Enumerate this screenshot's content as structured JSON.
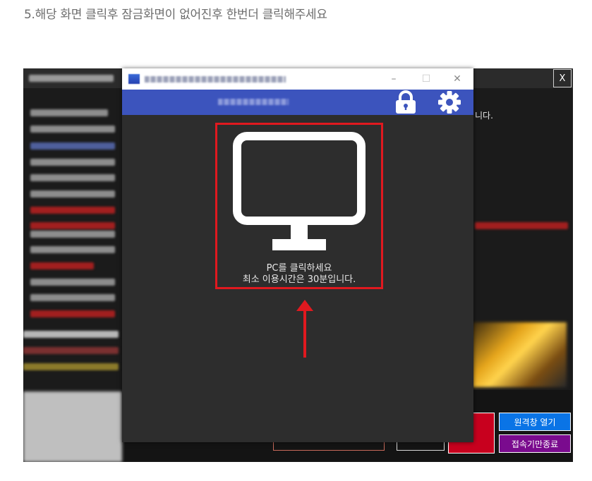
{
  "instruction": "5.해당 화면 클릭후 잠금화면이 없어진후 한번더 클릭해주세요",
  "background_app": {
    "close_label": "X",
    "notice_text": "니다.",
    "buttons": {
      "start_time_label": "",
      "usage_time_label": "",
      "pc_end_label": "",
      "remote_window_label": "원격창 열기",
      "disconnect_label": "접속기만종료"
    }
  },
  "lock_window": {
    "controls": {
      "minimize": "–",
      "maximize": "☐",
      "close": "✕"
    },
    "icons": {
      "lock": "lock-icon",
      "settings": "gear-icon",
      "monitor": "monitor-icon"
    },
    "click_prompt": "PC를 클릭하세요",
    "min_time_text": "최소 이용시간은 30분입니다."
  },
  "colors": {
    "header_blue": "#3c54bd",
    "highlight_red": "#e0191f",
    "window_bg": "#2d2d2d"
  }
}
